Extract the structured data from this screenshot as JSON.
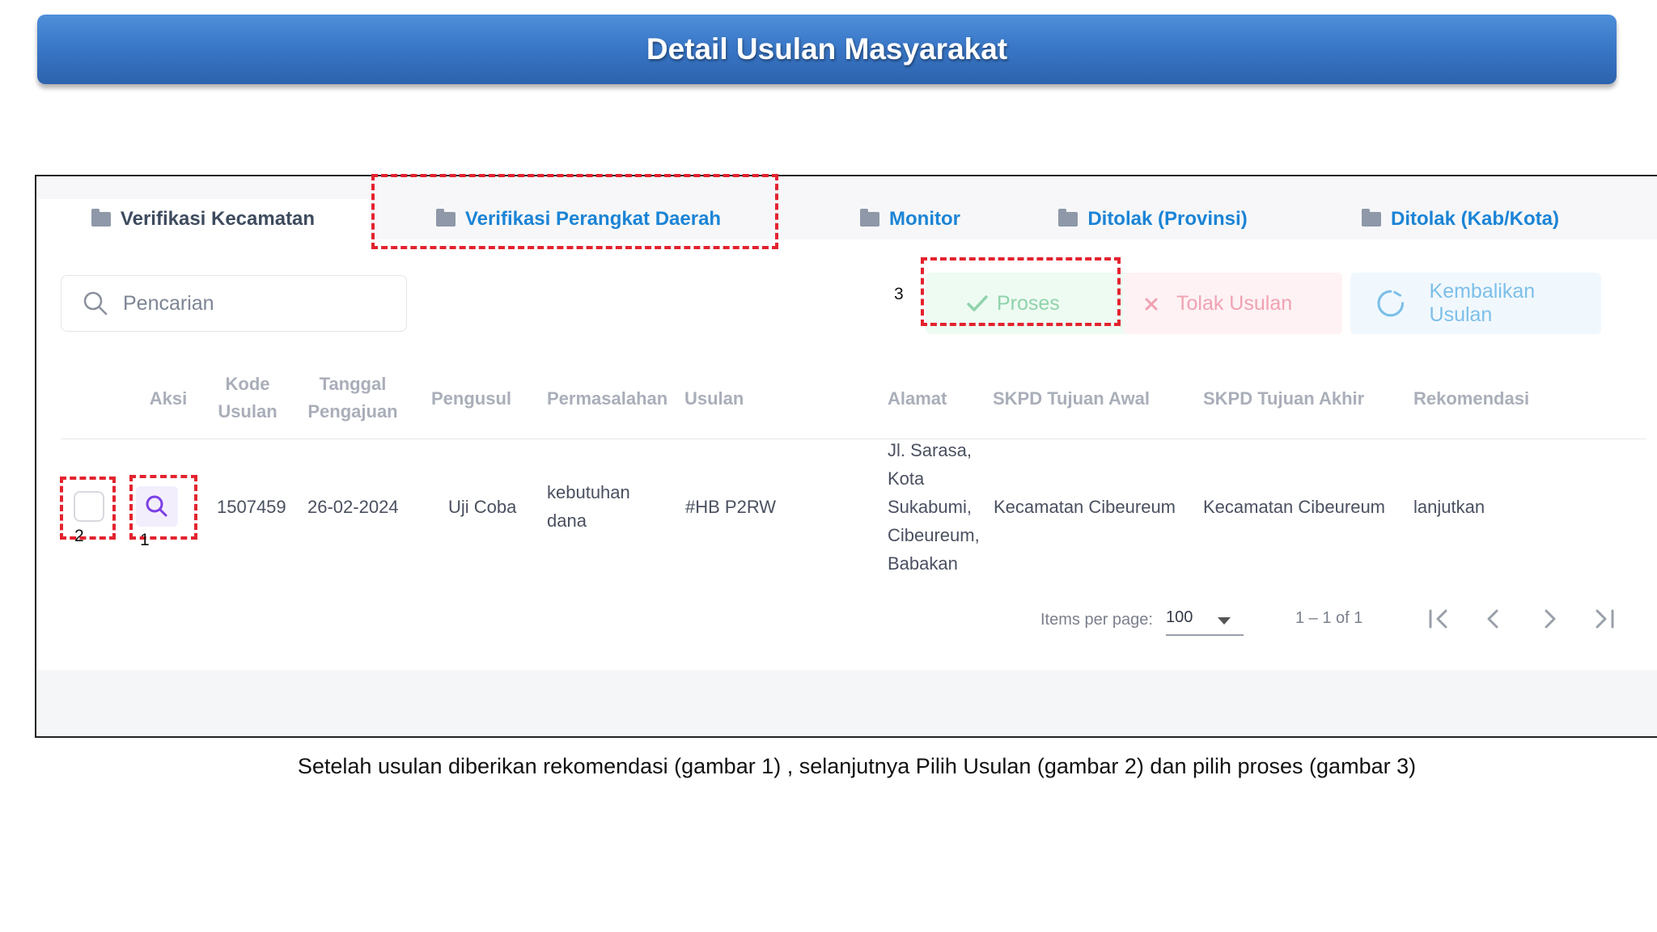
{
  "banner": {
    "title": "Detail Usulan Masyarakat"
  },
  "tabs": [
    {
      "label": "Verifikasi Kecamatan"
    },
    {
      "label": "Verifikasi Perangkat Daerah"
    },
    {
      "label": "Monitor"
    },
    {
      "label": "Ditolak (Provinsi)"
    },
    {
      "label": "Ditolak (Kab/Kota)"
    }
  ],
  "search": {
    "placeholder": "Pencarian"
  },
  "actions": {
    "proses": "Proses",
    "tolak": "Tolak Usulan",
    "kembalikan": "Kembalikan Usulan"
  },
  "table": {
    "headers": {
      "aksi": "Aksi",
      "kode_1": "Kode",
      "kode_2": "Usulan",
      "tanggal_1": "Tanggal",
      "tanggal_2": "Pengajuan",
      "pengusul": "Pengusul",
      "permasalahan": "Permasalahan",
      "usulan": "Usulan",
      "alamat": "Alamat",
      "skpd_awal": "SKPD Tujuan Awal",
      "skpd_akhir": "SKPD Tujuan Akhir",
      "rekomendasi": "Rekomendasi"
    },
    "row": {
      "kode": "1507459",
      "tanggal": "26-02-2024",
      "pengusul": "Uji Coba",
      "permasalahan_1": "kebutuhan",
      "permasalahan_2": "dana",
      "usulan": "#HB P2RW",
      "alamat_1": "Jl. Sarasa,",
      "alamat_2": "Kota",
      "alamat_3": "Sukabumi,",
      "alamat_4": "Cibeureum,",
      "alamat_5": "Babakan",
      "skpd_awal": "Kecamatan Cibeureum",
      "skpd_akhir": "Kecamatan Cibeureum",
      "rekomendasi": "lanjutkan"
    }
  },
  "pagination": {
    "items_label": "Items per page:",
    "page_size": "100",
    "range": "1 – 1 of 1"
  },
  "markers": {
    "m1": "1",
    "m2": "2",
    "m3": "3"
  },
  "caption": "Setelah usulan diberikan rekomendasi (gambar 1) , selanjutnya Pilih Usulan (gambar 2) dan pilih proses (gambar 3)",
  "colors": {
    "banner": "#3a78c8",
    "tab_link": "#1b84d6",
    "highlight": "#e3232e",
    "action_purple": "#7b3fe4"
  }
}
